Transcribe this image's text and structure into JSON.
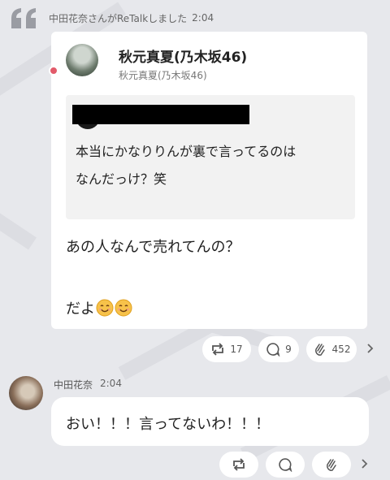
{
  "retalk": {
    "text": "中田花奈さんがReTalkしました",
    "time": "2:04",
    "icon": "quote-icon"
  },
  "post": {
    "author_name": "秋元真夏(乃木坂46)",
    "author_handle": "秋元真夏(乃木坂46)",
    "quoted": {
      "lines": [
        "本当にかなりりんが裏で言ってるのは",
        "なんだっけ？笑"
      ]
    },
    "body_lines": [
      "あの人なんで売れてんの？",
      "だよ"
    ],
    "emoji": "smiling-face-icon",
    "actions": {
      "retalk_count": "17",
      "comment_count": "9",
      "clap_count": "452"
    }
  },
  "reply": {
    "name": "中田花奈",
    "time": "2:04",
    "text": "おい！！！言ってないわ！！！"
  },
  "colors": {
    "background": "#e7e8ec",
    "card": "#ffffff",
    "quoted_bg": "#f2f2f2",
    "verified": "#e25a6a"
  }
}
